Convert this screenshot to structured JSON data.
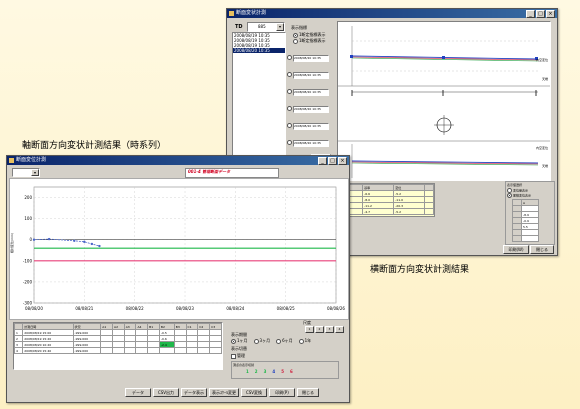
{
  "captions": {
    "axial": "軸断面方向変状計測結果（時系列）",
    "transverse": "横断面方向変状計測結果"
  },
  "win_back": {
    "title": "断面変状計測",
    "td_label": "TD",
    "td_value": "885",
    "display_group_title": "表示指標",
    "radio1": "1断定指標表示",
    "radio2": "1断定指標表示",
    "list_items": [
      "2008/08/19 10:35",
      "2008/08/19 10:35",
      "2008/08/19 10:35",
      "2008/08/20 10:35"
    ],
    "panel_dates": [
      "2008/08/20 10:35",
      "2008/08/20 10:35",
      "2008/08/20 10:35",
      "2008/08/20 10:35",
      "2008/08/20 10:35",
      "2008/08/20 10:35",
      "2008/08/20 10:35"
    ],
    "panel_button": "描画",
    "chart_labels": [
      "内空変位",
      "天端",
      "内空変位",
      "天端"
    ],
    "table": {
      "headers": [
        "",
        "基準",
        "変位",
        ""
      ],
      "rows": [
        [
          "A1",
          "-6.6",
          "-5.2",
          ""
        ],
        [
          "A2",
          "-8.0",
          "-11.0",
          ""
        ],
        [
          "A3",
          "-11.2",
          "-20.3",
          ""
        ],
        [
          "A4",
          "-4.7",
          "-5.2",
          ""
        ]
      ]
    },
    "right_group_title": "表示値選択",
    "right_radio1": "変位量表示",
    "right_radio2": "累積変位表示",
    "mini_headers": [
      "",
      "A"
    ],
    "mini_values": [
      "",
      "-8.9",
      "-0.9",
      "5.5",
      "",
      "",
      ""
    ],
    "buttons": [
      "印刷(W)",
      "閉じる"
    ]
  },
  "win_front": {
    "title": "断面変位計測",
    "combo_value": "",
    "chart_title_tag": "001-4 管理断面データ",
    "ylabel": "相対変位(mm)",
    "chart_data": {
      "type": "line",
      "ylim": [
        -300,
        250
      ],
      "yticks": [
        200,
        100,
        0,
        -100,
        -200,
        -300
      ],
      "xticks": [
        "08/08/20",
        "08/08/21",
        "08/08/22",
        "08/08/23",
        "08/08/24",
        "08/08/25",
        "08/08/26"
      ],
      "series": [
        {
          "color": "#4a66c8",
          "points": [
            [
              0.0,
              0
            ],
            [
              0.3,
              3
            ],
            [
              0.8,
              -5
            ],
            [
              1.0,
              -10
            ],
            [
              1.15,
              -20
            ],
            [
              1.3,
              -30
            ]
          ]
        }
      ],
      "hlines": [
        {
          "value": 0,
          "color": "#404040"
        },
        {
          "value": -40,
          "color": "#1fb84a"
        },
        {
          "value": -100,
          "color": "#e8407a"
        }
      ]
    },
    "table": {
      "headers": [
        "",
        "計測日時",
        "状況",
        "A1",
        "A2",
        "A3",
        "A4",
        "B1",
        "B2",
        "B3",
        "C1",
        "C2",
        "C3"
      ],
      "rows": [
        [
          "1",
          "2008/08/19 15:00",
          "-999.000",
          "",
          "",
          "",
          "",
          "",
          "-0.5",
          "",
          "",
          "",
          ""
        ],
        [
          "2",
          "2008/08/19 15:20",
          "-999.000",
          "",
          "",
          "",
          "",
          "",
          "-0.6",
          "",
          "",
          "",
          ""
        ],
        [
          "3",
          "2008/08/20 10:20",
          "-999.000",
          "",
          "",
          "",
          "",
          "",
          "-2.4",
          "",
          "",
          "",
          ""
        ],
        [
          "4",
          "2008/08/20 15:40",
          "-999.000",
          "",
          "",
          "",
          "",
          "",
          "",
          "",
          "",
          "",
          ""
        ]
      ]
    },
    "right_panel": {
      "zoom_label": "尺度",
      "zoom_btns": [
        "1",
        "2",
        "3",
        "4"
      ],
      "period_label": "表示期間",
      "periods": [
        "1ヶ月",
        "3ヶ月",
        "6ヶ月",
        "1年"
      ],
      "option_label": "表示切替",
      "check_label": "管理",
      "series_label": "測点の表示切替",
      "series_nums": [
        "1",
        "2",
        "3",
        "4",
        "5",
        "6"
      ]
    },
    "buttons": [
      "データ",
      "CSV出力",
      "データ表示",
      "表示ｽｹｰﾙ変更",
      "CSV変換",
      "印刷(P)",
      "閉じる"
    ]
  }
}
